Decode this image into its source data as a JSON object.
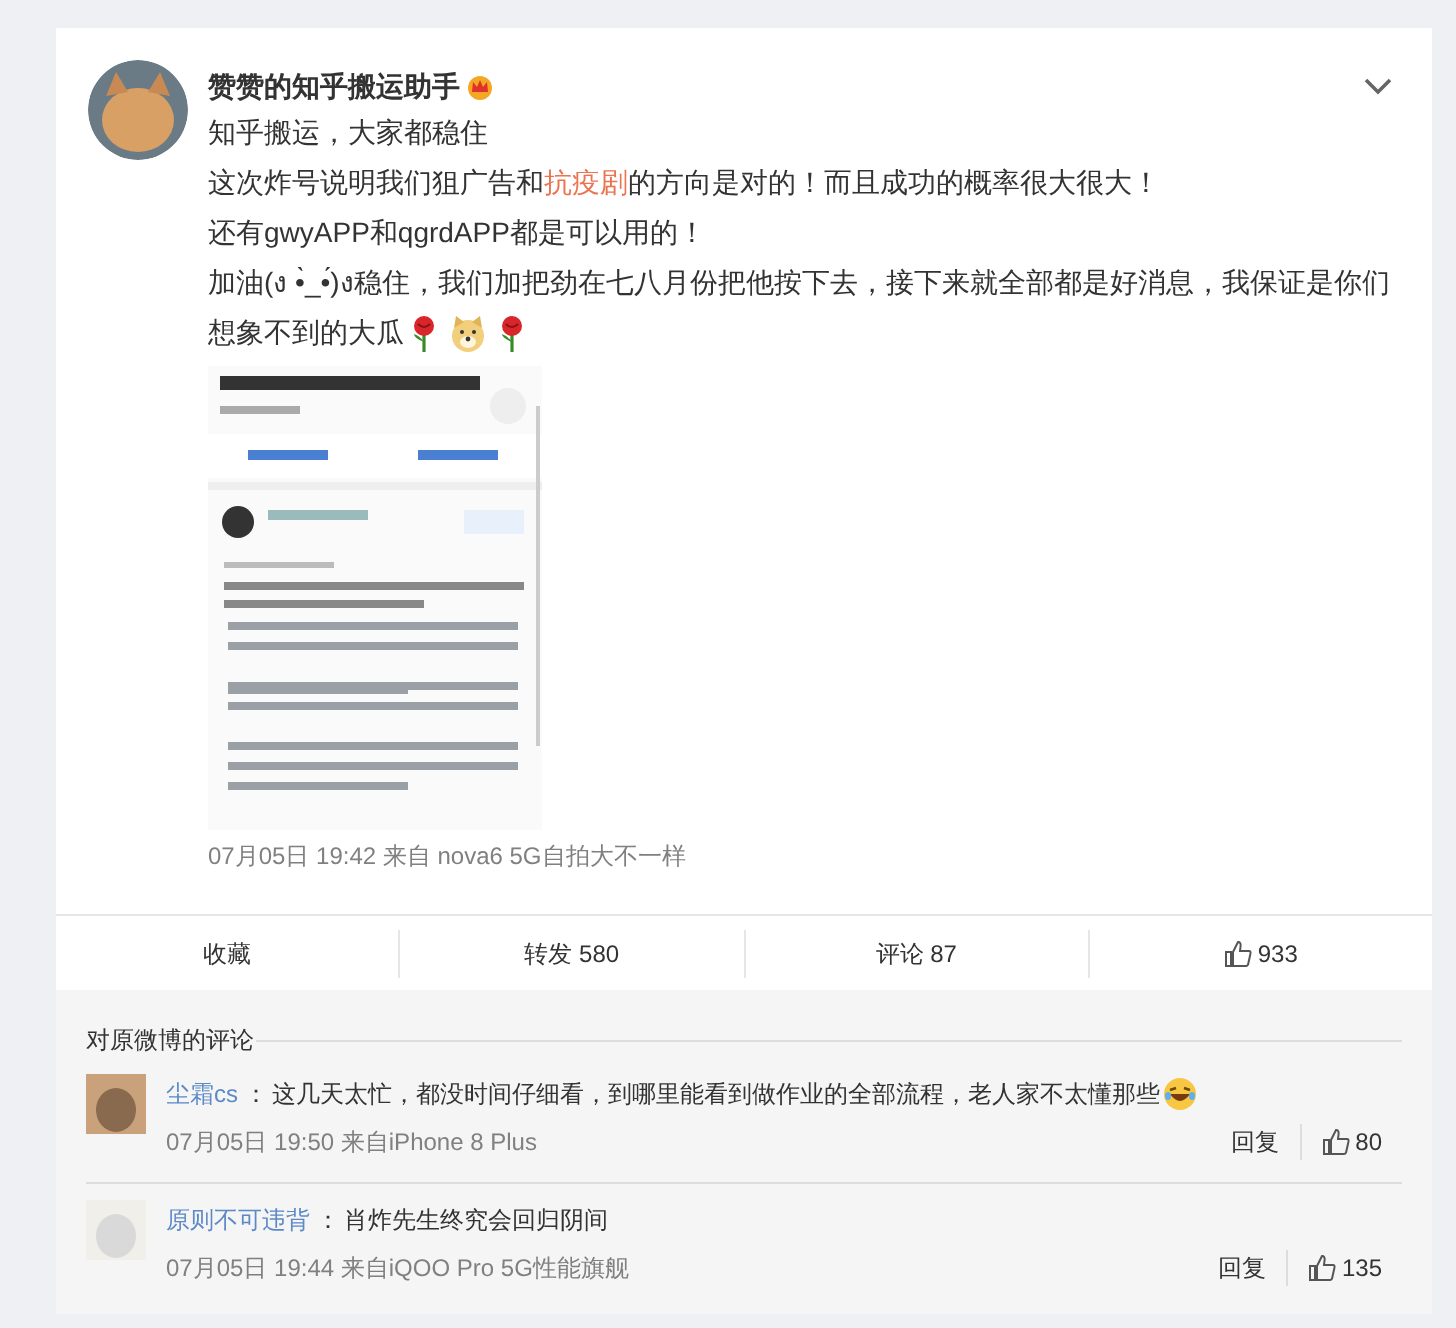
{
  "post": {
    "author": "赞赞的知乎搬运助手",
    "verified": true,
    "lines": [
      [
        {
          "kind": "plain",
          "text": "知乎搬运，大家都稳住"
        }
      ],
      [
        {
          "kind": "plain",
          "text": "这次炸号说明我们狙广告和"
        },
        {
          "kind": "highlight",
          "text": "抗疫剧"
        },
        {
          "kind": "plain",
          "text": "的方向是对的！而且成功的概率很大很大！"
        }
      ],
      [
        {
          "kind": "plain",
          "text": "还有gwyAPP和qgrdAPP都是可以用的！"
        }
      ],
      [
        {
          "kind": "plain",
          "text": "加油(ง •̀_•́)ง稳住，我们加把劲在七八月份把他按下去，接下来就全部都是好消息，我保证是你们"
        }
      ],
      [
        {
          "kind": "plain",
          "text": "想象不到的大瓜"
        },
        {
          "kind": "rose"
        },
        {
          "kind": "doge"
        },
        {
          "kind": "rose"
        }
      ]
    ],
    "image": {
      "kind": "picture"
    },
    "meta": "07月05日 19:42  来自 nova6 5G自拍大不一样",
    "actions": [
      {
        "kind": "text",
        "label": "收藏"
      },
      {
        "kind": "text",
        "label": "转发 580"
      },
      {
        "kind": "text",
        "label": "评论 87"
      },
      {
        "kind": "like",
        "label": "933"
      }
    ]
  },
  "comments": {
    "title": "对原微博的评论",
    "items": [
      {
        "user": "尘霜cs",
        "separator": "：",
        "text": "这几天太忙，都没时间仔细看，到哪里能看到做作业的全部流程，老人家不太懂那些",
        "emoji": true,
        "meta": "07月05日 19:50 来自iPhone 8 Plus",
        "reply": "回复",
        "likes": "80"
      },
      {
        "user": "原则不可违背",
        "separator": "：",
        "text": "肖炸先生终究会回归阴间",
        "emoji": false,
        "meta": "07月05日 19:44 来自iQOO Pro 5G性能旗舰",
        "reply": "回复",
        "likes": "135"
      }
    ]
  }
}
